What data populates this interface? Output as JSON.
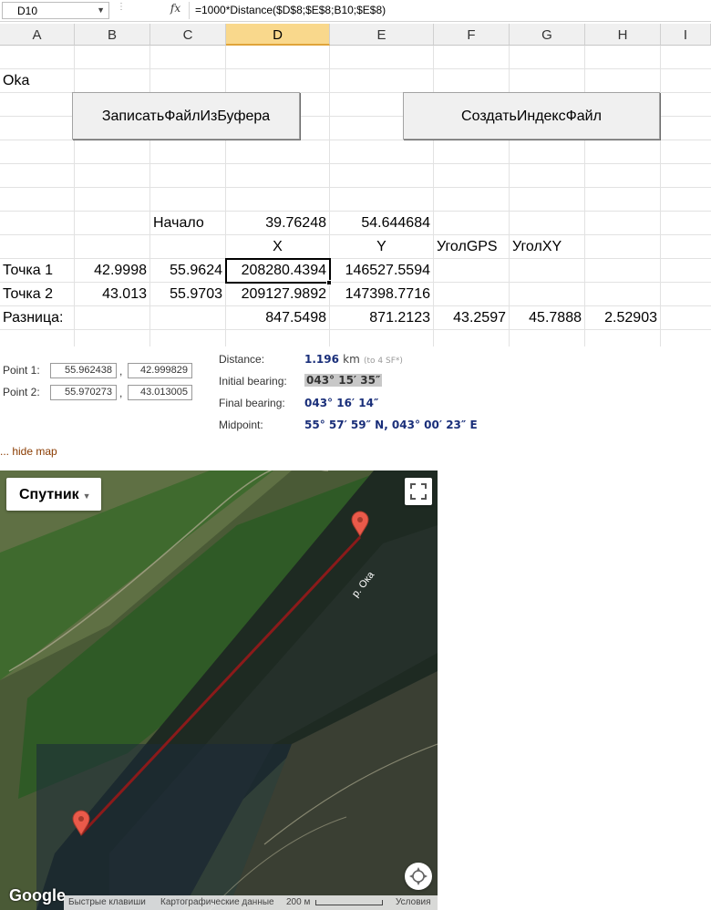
{
  "formula_bar": {
    "cell_ref": "D10",
    "fx": "fx",
    "formula": "=1000*Distance($D$8;$E$8;B10;$E$8)"
  },
  "columns": [
    "A",
    "B",
    "C",
    "D",
    "E",
    "F",
    "G",
    "H",
    "I"
  ],
  "selected_column": "D",
  "sheet": {
    "a3": "Oka",
    "button_write": "ЗаписатьФайлИзБуфера",
    "button_index": "СоздатьИндексФайл",
    "start_label": "Начало",
    "start_x": "39.76248",
    "start_y": "54.644684",
    "hdr_x": "X",
    "hdr_y": "Y",
    "hdr_angle_gps": "УголGPS",
    "hdr_angle_xy": "УголXY",
    "p1_label": "Точка 1",
    "p1_b": "42.9998",
    "p1_c": "55.9624",
    "p1_x": "208280.4394",
    "p1_y": "146527.5594",
    "p2_label": "Точка 2",
    "p2_b": "43.013",
    "p2_c": "55.9703",
    "p2_x": "209127.9892",
    "p2_y": "147398.7716",
    "diff_label": "Разница:",
    "diff_x": "847.5498",
    "diff_y": "871.2123",
    "diff_gps": "43.2597",
    "diff_xy": "45.7888",
    "diff_h": "2.52903"
  },
  "calculator": {
    "point1_label": "Point 1:",
    "point1_lat": "55.962438",
    "point1_lon": "42.999829",
    "point2_label": "Point 2:",
    "point2_lat": "55.970273",
    "point2_lon": "43.013005",
    "comma": ",",
    "distance_label": "Distance:",
    "distance_value": "1.196",
    "distance_unit": "km",
    "distance_note": "(to 4 SF*)",
    "initial_bearing_label": "Initial bearing:",
    "initial_bearing_value": "043° 15′ 35″",
    "final_bearing_label": "Final bearing:",
    "final_bearing_value": "043° 16′ 14″",
    "midpoint_label": "Midpoint:",
    "midpoint_value": "55° 57′ 59″ N, 043° 00′ 23″ E",
    "hide_map": "... hide map"
  },
  "map": {
    "map_type": "Спутник",
    "river_label": "р. Ока",
    "logo": "Google",
    "footer_shortcuts": "Быстрые клавиши",
    "footer_data": "Картографические данные",
    "footer_scale": "200 м",
    "footer_terms": "Условия",
    "line_color": "#8b1a1a",
    "marker_color": "#ea5a4a"
  }
}
